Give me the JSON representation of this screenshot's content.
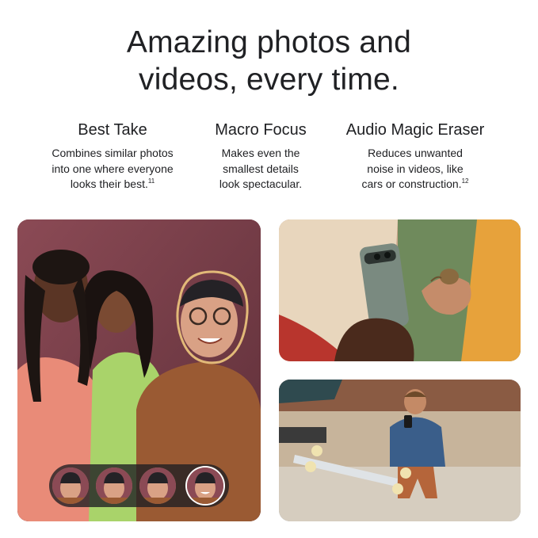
{
  "headline": {
    "line1": "Amazing photos and",
    "line2": "videos, every time."
  },
  "features": [
    {
      "title": "Best Take",
      "description_lines": [
        "Combines similar photos",
        "into one where everyone",
        "looks their best."
      ],
      "footnote": "11"
    },
    {
      "title": "Macro Focus",
      "description_lines": [
        "Makes even the",
        "smallest details",
        "look spectacular."
      ],
      "footnote": ""
    },
    {
      "title": "Audio Magic Eraser",
      "description_lines": [
        "Reduces unwanted",
        "noise in videos, like",
        "cars or construction."
      ],
      "footnote": "12"
    }
  ],
  "images": {
    "best_take": "group photo of three friends with highlighted face",
    "macro": "hands holding a phone photographing a snail",
    "skate": "person filming a skateboarder with a phone"
  },
  "best_take_thumbnails": {
    "count": 4,
    "selected_index": 3
  },
  "colors": {
    "text": "#202124",
    "highlight_ring": "#e2b978",
    "strip": "#1e1e23"
  }
}
